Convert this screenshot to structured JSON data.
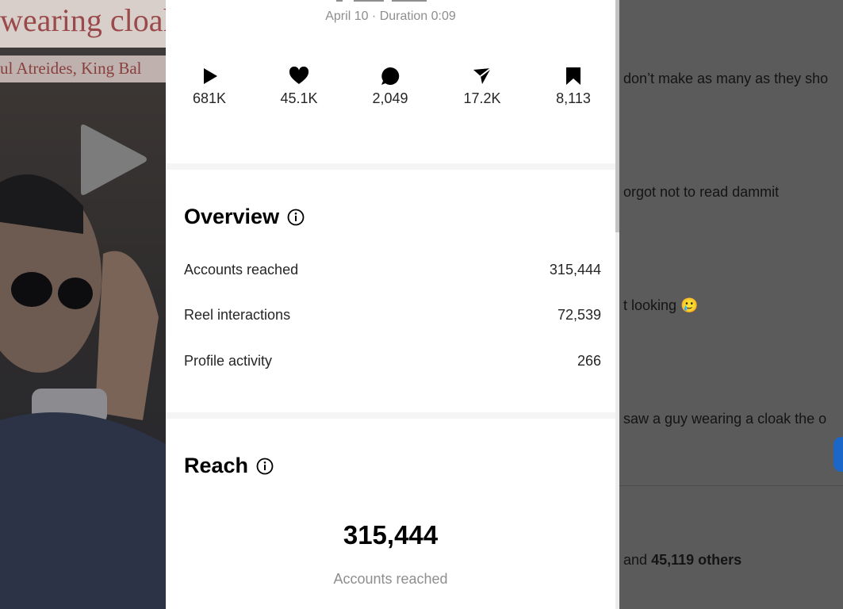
{
  "background_post": {
    "title_text": "wearing cloak",
    "subtitle_text": "ul Atreides, King Bal",
    "comments": [
      "don’t make as many as they sho",
      "orgot not to read dammit",
      "t looking 🥲",
      "saw a guy wearing a cloak the o"
    ],
    "likes_prefix": "and",
    "likes_others": "45,119 others"
  },
  "insights": {
    "date_line": "April 10 · Duration 0:09",
    "stats": [
      {
        "icon": "play-icon",
        "value": "681K"
      },
      {
        "icon": "heart-icon",
        "value": "45.1K"
      },
      {
        "icon": "comment-icon",
        "value": "2,049"
      },
      {
        "icon": "share-icon",
        "value": "17.2K"
      },
      {
        "icon": "bookmark-icon",
        "value": "8,113"
      }
    ],
    "overview": {
      "title": "Overview",
      "rows": [
        {
          "label": "Accounts reached",
          "value": "315,444"
        },
        {
          "label": "Reel interactions",
          "value": "72,539"
        },
        {
          "label": "Profile activity",
          "value": "266"
        }
      ]
    },
    "reach": {
      "title": "Reach",
      "value": "315,444",
      "caption": "Accounts reached"
    }
  },
  "colors": {
    "overlay_dim": "#5b5b5b",
    "panel_bg": "#ffffff",
    "muted_text": "#8e8e8e",
    "accent_blue": "#1b66c9"
  }
}
